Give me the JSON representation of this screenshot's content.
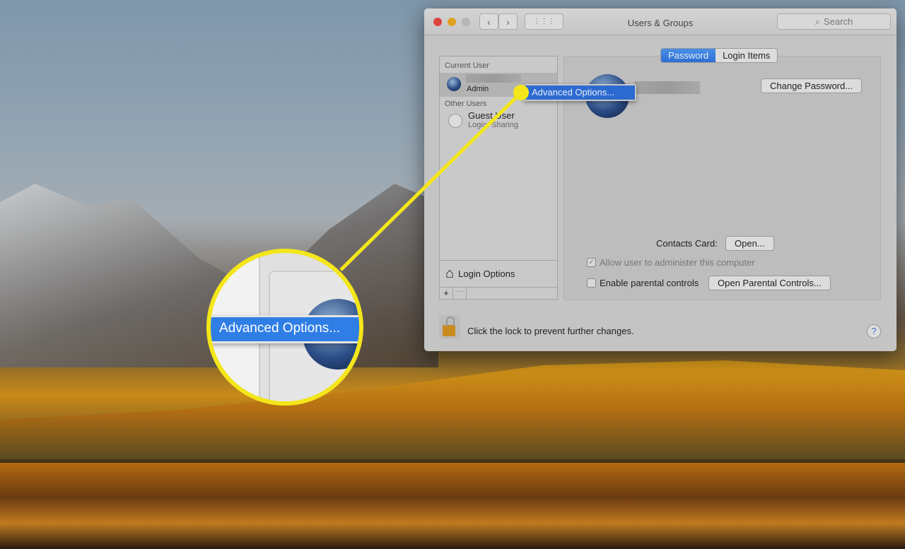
{
  "window": {
    "title": "Users & Groups",
    "search_placeholder": "Search"
  },
  "sidebar": {
    "current_user_header": "Current User",
    "current_user_role": "Admin",
    "other_users_header": "Other Users",
    "guest_name": "Guest User",
    "guest_detail": "Login, Sharing",
    "login_options": "Login Options",
    "add": "+",
    "remove": "—"
  },
  "tabs": [
    {
      "label": "Password",
      "active": true
    },
    {
      "label": "Login Items",
      "active": false
    }
  ],
  "main": {
    "change_password": "Change Password...",
    "contacts_card_label": "Contacts Card:",
    "open": "Open...",
    "allow_admin": "Allow user to administer this computer",
    "allow_admin_checked": true,
    "parental": "Enable parental controls",
    "parental_checked": false,
    "open_parental": "Open Parental Controls..."
  },
  "context_menu": {
    "item": "Advanced Options..."
  },
  "footer": {
    "lock_text": "Click the lock to prevent further changes.",
    "help": "?"
  },
  "callout": {
    "color": "#f4e61a",
    "zoom_text": "Advanced Options..."
  }
}
